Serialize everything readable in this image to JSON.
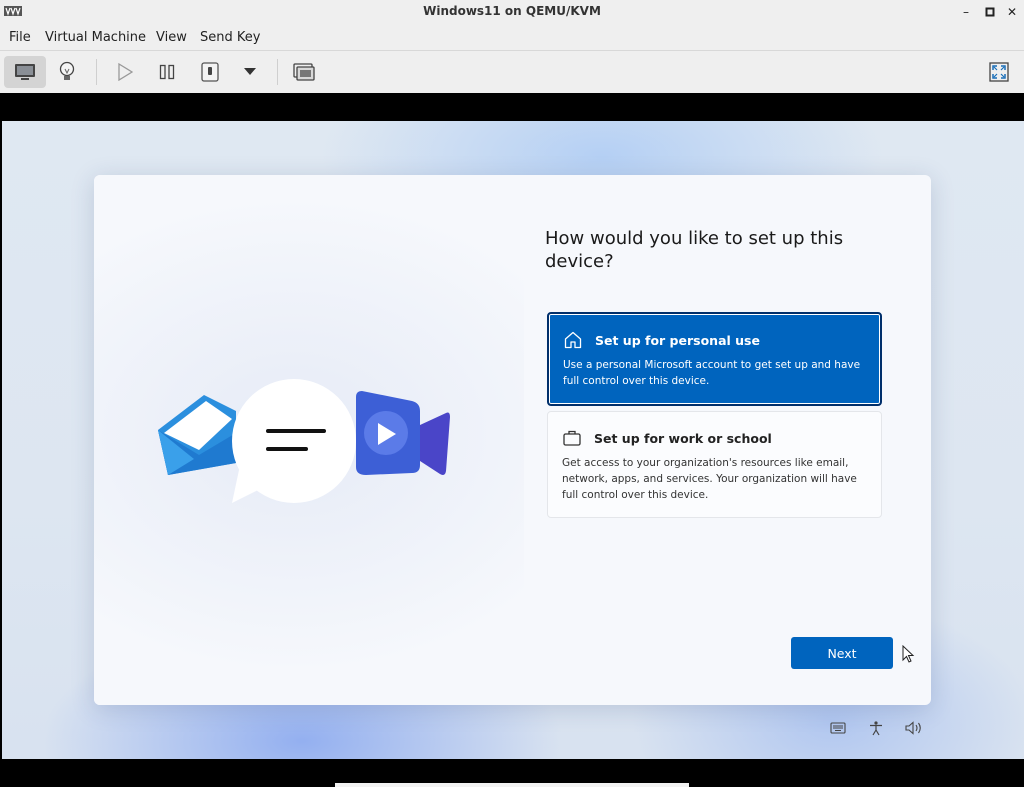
{
  "window": {
    "title": "Windows11 on QEMU/KVM",
    "minimize_glyph": "–",
    "maximize_glyph": "▫",
    "close_glyph": "✕"
  },
  "menu": {
    "items": [
      "File",
      "Virtual Machine",
      "View",
      "Send Key"
    ]
  },
  "toolbar": {
    "buttons": [
      "console-icon",
      "details-lightbulb-icon",
      "run-icon",
      "pause-icon",
      "shutdown-icon",
      "shutdown-menu-chevron-icon",
      "snapshots-icon",
      "fullscreen-icon"
    ]
  },
  "oobe": {
    "heading": "How would you like to set up this device?",
    "options": [
      {
        "title": "Set up for personal use",
        "description": "Use a personal Microsoft account to get set up and have full control over this device.",
        "icon": "home-icon",
        "selected": true
      },
      {
        "title": "Set up for work or school",
        "description": "Get access to your organization's resources like email, network, apps, and services. Your organization will have full control over this device.",
        "icon": "briefcase-icon",
        "selected": false
      }
    ],
    "next_label": "Next",
    "tray_icons": [
      "keyboard-icon",
      "accessibility-icon",
      "volume-icon"
    ]
  },
  "colors": {
    "accent": "#0064be",
    "selected_border": "#002f6b",
    "card_bg": "#f6f8fc",
    "chrome_bg": "#efefef"
  }
}
